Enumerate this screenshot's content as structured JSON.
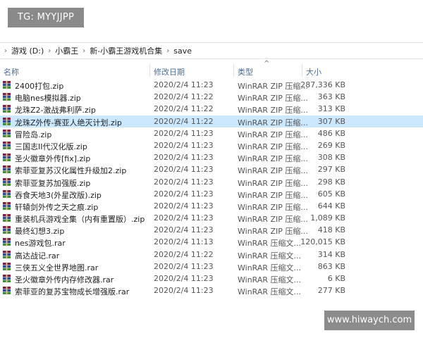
{
  "overlay": {
    "tg_label": "TG: MYYJJPP",
    "watermark": "www.hiwaych.com"
  },
  "breadcrumb": [
    "游戏 (D:)",
    "小霸王",
    "新-小霸王游戏机合集",
    "save"
  ],
  "columns": {
    "name": "名称",
    "date": "修改日期",
    "type": "类型",
    "size": "大小"
  },
  "icons": {
    "file": "winrar-archive-icon",
    "sort": "sort-up-icon",
    "separator": "chevron-right-icon"
  },
  "files": [
    {
      "name": "2400打包.zip",
      "date": "2020/2/4 11:23",
      "type": "WinRAR ZIP 压缩...",
      "size": "287,336 KB"
    },
    {
      "name": "电脑nes模拟器.zip",
      "date": "2020/2/4 11:22",
      "type": "WinRAR ZIP 压缩...",
      "size": "363 KB"
    },
    {
      "name": "龙珠Z2-激战弗利萨.zip",
      "date": "2020/2/4 11:22",
      "type": "WinRAR ZIP 压缩...",
      "size": "313 KB"
    },
    {
      "name": "龙珠Z外传-赛亚人绝灭计划.zip",
      "date": "2020/2/4 11:22",
      "type": "WinRAR ZIP 压缩...",
      "size": "307 KB",
      "selected": true
    },
    {
      "name": "冒险岛.zip",
      "date": "2020/2/4 11:23",
      "type": "WinRAR ZIP 压缩...",
      "size": "486 KB"
    },
    {
      "name": "三国志II代汉化版.zip",
      "date": "2020/2/4 11:23",
      "type": "WinRAR ZIP 压缩...",
      "size": "269 KB"
    },
    {
      "name": "圣火徽章外传[fix].zip",
      "date": "2020/2/4 11:23",
      "type": "WinRAR ZIP 压缩...",
      "size": "308 KB"
    },
    {
      "name": "索菲亚复苏汉化属性升级加2.zip",
      "date": "2020/2/4 11:23",
      "type": "WinRAR ZIP 压缩...",
      "size": "297 KB"
    },
    {
      "name": "索菲亚复苏加强版.zip",
      "date": "2020/2/4 11:23",
      "type": "WinRAR ZIP 压缩...",
      "size": "298 KB"
    },
    {
      "name": "吞食天地3(外星改版).zip",
      "date": "2020/2/4 11:23",
      "type": "WinRAR ZIP 压缩...",
      "size": "605 KB"
    },
    {
      "name": "轩辕剑外传之天之痕.zip",
      "date": "2020/2/4 11:23",
      "type": "WinRAR ZIP 压缩...",
      "size": "644 KB"
    },
    {
      "name": "重装机兵游戏全集（内有重置版）.zip",
      "date": "2020/2/4 11:23",
      "type": "WinRAR ZIP 压缩...",
      "size": "1,089 KB"
    },
    {
      "name": "最终幻想3.zip",
      "date": "2020/2/4 11:23",
      "type": "WinRAR ZIP 压缩...",
      "size": "418 KB"
    },
    {
      "name": "nes游戏包.rar",
      "date": "2020/2/4 11:13",
      "type": "WinRAR 压缩文...",
      "size": "120,015 KB"
    },
    {
      "name": "高达战记.rar",
      "date": "2020/2/4 11:22",
      "type": "WinRAR 压缩文...",
      "size": "314 KB"
    },
    {
      "name": "三侠五义全世界地图.rar",
      "date": "2020/2/4 11:23",
      "type": "WinRAR 压缩文...",
      "size": "863 KB"
    },
    {
      "name": "圣火徽章外传内存修改器.rar",
      "date": "2020/2/4 11:23",
      "type": "WinRAR 压缩文...",
      "size": "6 KB"
    },
    {
      "name": "索菲亚的复苏宝物成长增强版.rar",
      "date": "2020/2/4 11:23",
      "type": "WinRAR 压缩文...",
      "size": "277 KB"
    }
  ]
}
